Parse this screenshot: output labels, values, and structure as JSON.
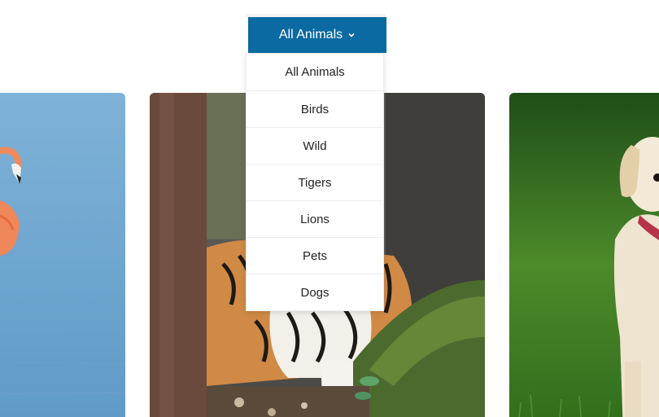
{
  "filter": {
    "selected_label": "All Animals",
    "toggle_icon": "chevron-down-icon",
    "accent_color": "#0b6aa2",
    "options": [
      "All Animals",
      "Birds",
      "Wild",
      "Tigers",
      "Lions",
      "Pets",
      "Dogs"
    ]
  },
  "gallery": {
    "images": [
      {
        "subject": "flamingo"
      },
      {
        "subject": "tiger"
      },
      {
        "subject": "puppy"
      }
    ]
  }
}
